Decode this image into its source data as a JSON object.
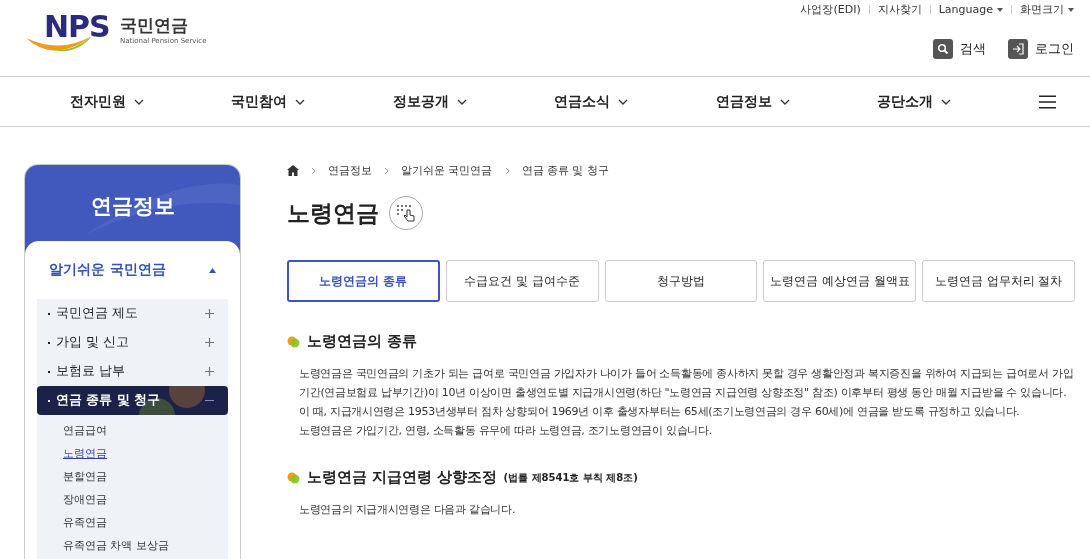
{
  "logo": {
    "mark": "NPS",
    "name": "국민연금",
    "subtitle": "National Pension Service"
  },
  "utility_links": [
    {
      "label": "사업장(EDI)",
      "kind": "link"
    },
    {
      "label": "지사찾기",
      "kind": "link"
    },
    {
      "label": "Language",
      "kind": "dropdown"
    },
    {
      "label": "화면크기",
      "kind": "dropdown"
    }
  ],
  "header_actions": [
    {
      "label": "검색",
      "kind": "search"
    },
    {
      "label": "로그인",
      "kind": "login"
    }
  ],
  "nav": [
    "전자민원",
    "국민참여",
    "정보공개",
    "연금소식",
    "연금정보",
    "공단소개"
  ],
  "sidebar": {
    "title": "연금정보",
    "section": {
      "label": "알기쉬운 국민연금",
      "expanded": true,
      "items": [
        {
          "label": "국민연금 제도",
          "expanded": false
        },
        {
          "label": "가입 및 신고",
          "expanded": false
        },
        {
          "label": "보험료 납부",
          "expanded": false
        },
        {
          "label": "연금 종류 및 청구",
          "expanded": true,
          "children": [
            {
              "label": "연금급여",
              "selected": false
            },
            {
              "label": "노령연금",
              "selected": true
            },
            {
              "label": "분할연금",
              "selected": false
            },
            {
              "label": "장애연금",
              "selected": false
            },
            {
              "label": "유족연금",
              "selected": false
            },
            {
              "label": "유족연금 차액 보상금",
              "selected": false
            }
          ]
        }
      ]
    }
  },
  "breadcrumb": [
    "연금정보",
    "알기쉬운 국민연금",
    "연금 종류 및 청구"
  ],
  "page_title": "노령연금",
  "tabs": [
    {
      "label": "노령연금의 종류",
      "selected": true
    },
    {
      "label": "수급요건 및 급여수준",
      "selected": false
    },
    {
      "label": "청구방법",
      "selected": false
    },
    {
      "label": "노령연금 예상연금 월액표",
      "selected": false
    },
    {
      "label": "노령연금 업무처리 절차",
      "selected": false
    }
  ],
  "sections": [
    {
      "heading": "노령연금의 종류",
      "paragraphs": [
        "노령연금은 국민연금의 기초가 되는 급여로 국민연금 가입자가 나이가 들어 소득활동에 종사하지 못할 경우 생활안정과 복지증진을 위하여 지급되는 급여로서 가입기간(연금보험료 납부기간)이 10년 이상이면 출생연도별 지급개시연령(하단 \"노령연금 지급연령 상향조정\" 참조) 이후부터 평생 동안 매월 지급받을 수 있습니다. 이 때, 지급개시연령은 1953년생부터 점차 상향되어 1969년 이후 출생자부터는 65세(조기노령연금의 경우 60세)에 연금을 받도록 규정하고 있습니다.",
        "노령연금은 가입기간, 연령, 소득활동 유무에 따라 노령연금, 조기노령연금이 있습니다."
      ]
    },
    {
      "heading": "노령연금 지급연령 상향조정",
      "note": "(법률 제8541호 부칙 제8조)",
      "paragraphs": [
        "노령연금의 지급개시연령은 다음과 같습니다."
      ]
    }
  ]
}
